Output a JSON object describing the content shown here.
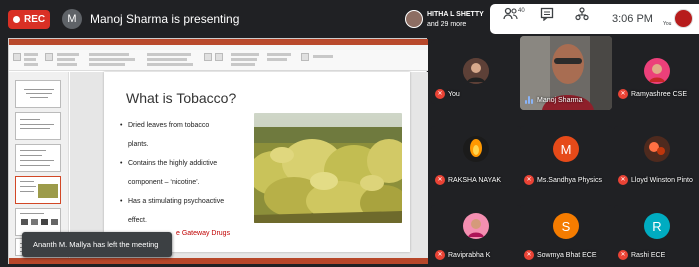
{
  "meeting": {
    "rec_label": "REC",
    "presenter_initial": "M",
    "presenting_text": "Manoj Sharma is presenting",
    "host_name": "HITHA L SHETTY",
    "host_more": "and 29 more",
    "people_count": "40",
    "clock": "3:06 PM",
    "you_label": "You"
  },
  "presentation": {
    "slide_title": "What is Tobacco?",
    "bullets": [
      "Dried leaves from tobacco",
      "plants.",
      "Contains the highly addictive",
      "component – ‘nicotine’.",
      "Has a stimulating psychoactive",
      "effect."
    ],
    "red_text": "e Gateway Drugs"
  },
  "toast": {
    "text": "Ananth M. Mallya has left the meeting"
  },
  "participants": [
    {
      "name": "You",
      "mic": "off",
      "avatar_color": "#6d4c41"
    },
    {
      "name": "Manoj Sharma",
      "mic": "speaking",
      "avatar_color": "#9e9e9e"
    },
    {
      "name": "Ramyashree CSE",
      "mic": "off",
      "avatar_color": "#ef5350"
    },
    {
      "name": "RAKSHA NAYAK",
      "mic": "off",
      "avatar_color": "#ff9800"
    },
    {
      "name": "Ms.Sandhya Physics",
      "mic": "off",
      "avatar_color": "#e64a19",
      "initial": "M"
    },
    {
      "name": "Lloyd Winston Pinto",
      "mic": "off",
      "avatar_color": "#bf360c"
    },
    {
      "name": "Raviprabha K",
      "mic": "off",
      "avatar_color": "#ec407a"
    },
    {
      "name": "Sowmya Bhat ECE",
      "mic": "off",
      "avatar_color": "#f57c00",
      "initial": "S"
    },
    {
      "name": "Rashi ECE",
      "mic": "off",
      "avatar_color": "#00acc1",
      "initial": "R"
    }
  ],
  "colors": {
    "rec": "#d93025",
    "mic_off": "#ea4335",
    "ppt_accent": "#b7472a",
    "tile_bg": "#3c4043"
  }
}
